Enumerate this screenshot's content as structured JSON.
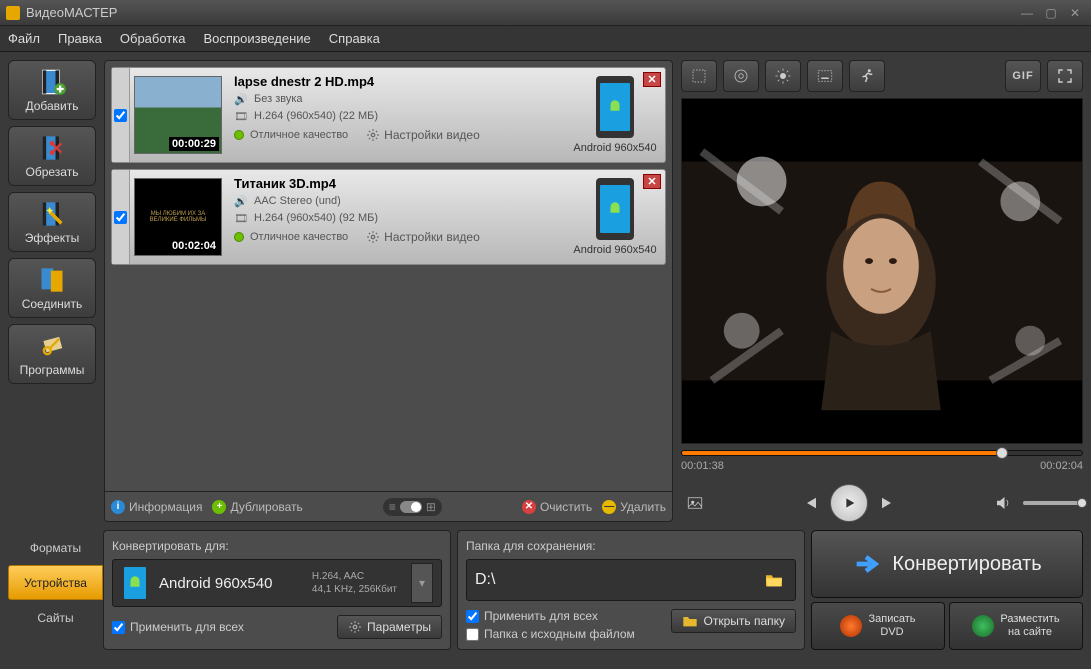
{
  "window": {
    "title": "ВидеоМАСТЕР"
  },
  "menu": [
    "Файл",
    "Правка",
    "Обработка",
    "Воспроизведение",
    "Справка"
  ],
  "sidebar": [
    {
      "label": "Добавить"
    },
    {
      "label": "Обрезать"
    },
    {
      "label": "Эффекты"
    },
    {
      "label": "Соединить"
    },
    {
      "label": "Программы"
    }
  ],
  "items": [
    {
      "checked": true,
      "name": "lapse dnestr 2 HD.mp4",
      "duration": "00:00:29",
      "audio": "Без звука",
      "codec": "H.264 (960x540) (22 МБ)",
      "quality": "Отличное качество",
      "settings": "Настройки видео",
      "device": "Android 960x540"
    },
    {
      "checked": true,
      "name": "Титаник 3D.mp4",
      "duration": "00:02:04",
      "audio": "AAC Stereo (und)",
      "codec": "H.264 (960x540) (92 МБ)",
      "quality": "Отличное качество",
      "settings": "Настройки видео",
      "device": "Android 960x540"
    }
  ],
  "listtoolbar": {
    "info": "Информация",
    "dup": "Дублировать",
    "clear": "Очистить",
    "del": "Удалить"
  },
  "preview": {
    "gif": "GIF",
    "current": "00:01:38",
    "total": "00:02:04"
  },
  "tabs": {
    "formats": "Форматы",
    "devices": "Устройства",
    "sites": "Сайты"
  },
  "convert": {
    "title": "Конвертировать для:",
    "device": "Android 960x540",
    "codecs": "H.264, AAC",
    "rate": "44,1 KHz, 256Кбит",
    "apply": "Применить для всех",
    "params": "Параметры"
  },
  "save": {
    "title": "Папка для сохранения:",
    "path": "D:\\",
    "apply": "Применить для всех",
    "src": "Папка с исходным файлом",
    "open": "Открыть папку"
  },
  "actions": {
    "convert": "Конвертировать",
    "dvd": "Записать\nDVD",
    "site": "Разместить\nна сайте"
  }
}
